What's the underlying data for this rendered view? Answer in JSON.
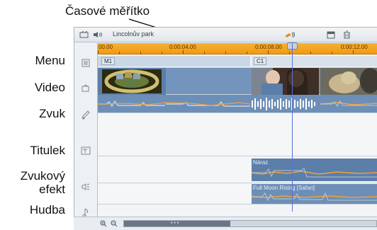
{
  "callout": {
    "text": "Časové měřítko"
  },
  "side_labels": {
    "menu": "Menu",
    "video": "Video",
    "zvuk": "Zvuk",
    "titulek": "Titulek",
    "zvukovy_efekt_line1": "Zvukový",
    "zvukovy_efekt_line2": "efekt",
    "hudba": "Hudba"
  },
  "toolbar": {
    "project_name": "Lincolnův park",
    "left_icons": [
      "film-track-icon",
      "speaker-icon"
    ],
    "right_icons": [
      "razor-icon",
      "window-icon",
      "trash-icon"
    ]
  },
  "ruler": {
    "labels": [
      "00.00",
      "0:00:04.00",
      "0:00:08.00",
      "0:00:12.00"
    ]
  },
  "tracks": {
    "menu_clip": "M1",
    "chapter_clip": "C1",
    "sfx_clip": "Náraz",
    "music_clip": "Full Moon Rising [Safari]"
  },
  "track_icons": {
    "menu": "menu-icon",
    "video": "video-icon",
    "audio": "audio-icon",
    "title": "title-icon",
    "sfx": "sound-effect-icon",
    "music": "music-icon"
  },
  "colors": {
    "ruler": "#f19a12",
    "clip_blue": "#6d8fb7",
    "waveform_orange": "#f2a23b",
    "playhead": "#5b6fd2"
  }
}
